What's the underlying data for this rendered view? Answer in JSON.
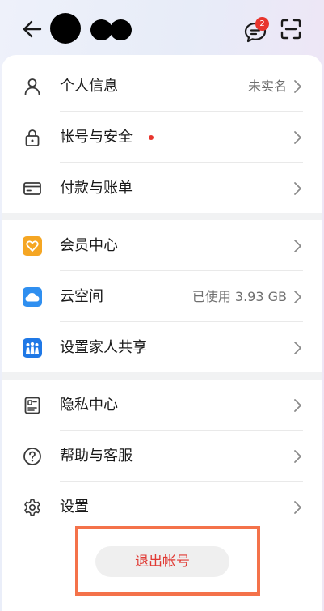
{
  "header": {
    "message_badge_count": "2",
    "icons": [
      "back-arrow-icon",
      "chat-bubble-icon",
      "scan-icon"
    ]
  },
  "menu": {
    "group1": [
      {
        "label": "个人信息",
        "value": "未实名",
        "icon": "person-icon"
      },
      {
        "label": "帐号与安全",
        "value": "",
        "icon": "lock-icon",
        "dot": true
      },
      {
        "label": "付款与账单",
        "value": "",
        "icon": "card-icon"
      }
    ],
    "group2": [
      {
        "label": "会员中心",
        "value": "",
        "icon": "member-heart-icon"
      },
      {
        "label": "云空间",
        "value": "已使用 3.93 GB",
        "icon": "cloud-icon"
      },
      {
        "label": "设置家人共享",
        "value": "",
        "icon": "family-share-icon"
      }
    ],
    "group3": [
      {
        "label": "隐私中心",
        "value": "",
        "icon": "privacy-id-icon"
      },
      {
        "label": "帮助与客服",
        "value": "",
        "icon": "help-icon"
      },
      {
        "label": "设置",
        "value": "",
        "icon": "settings-gear-icon"
      }
    ]
  },
  "logout": {
    "label": "退出帐号"
  },
  "colors": {
    "accent_red": "#e8352d",
    "highlight_orange": "#f4724a"
  }
}
